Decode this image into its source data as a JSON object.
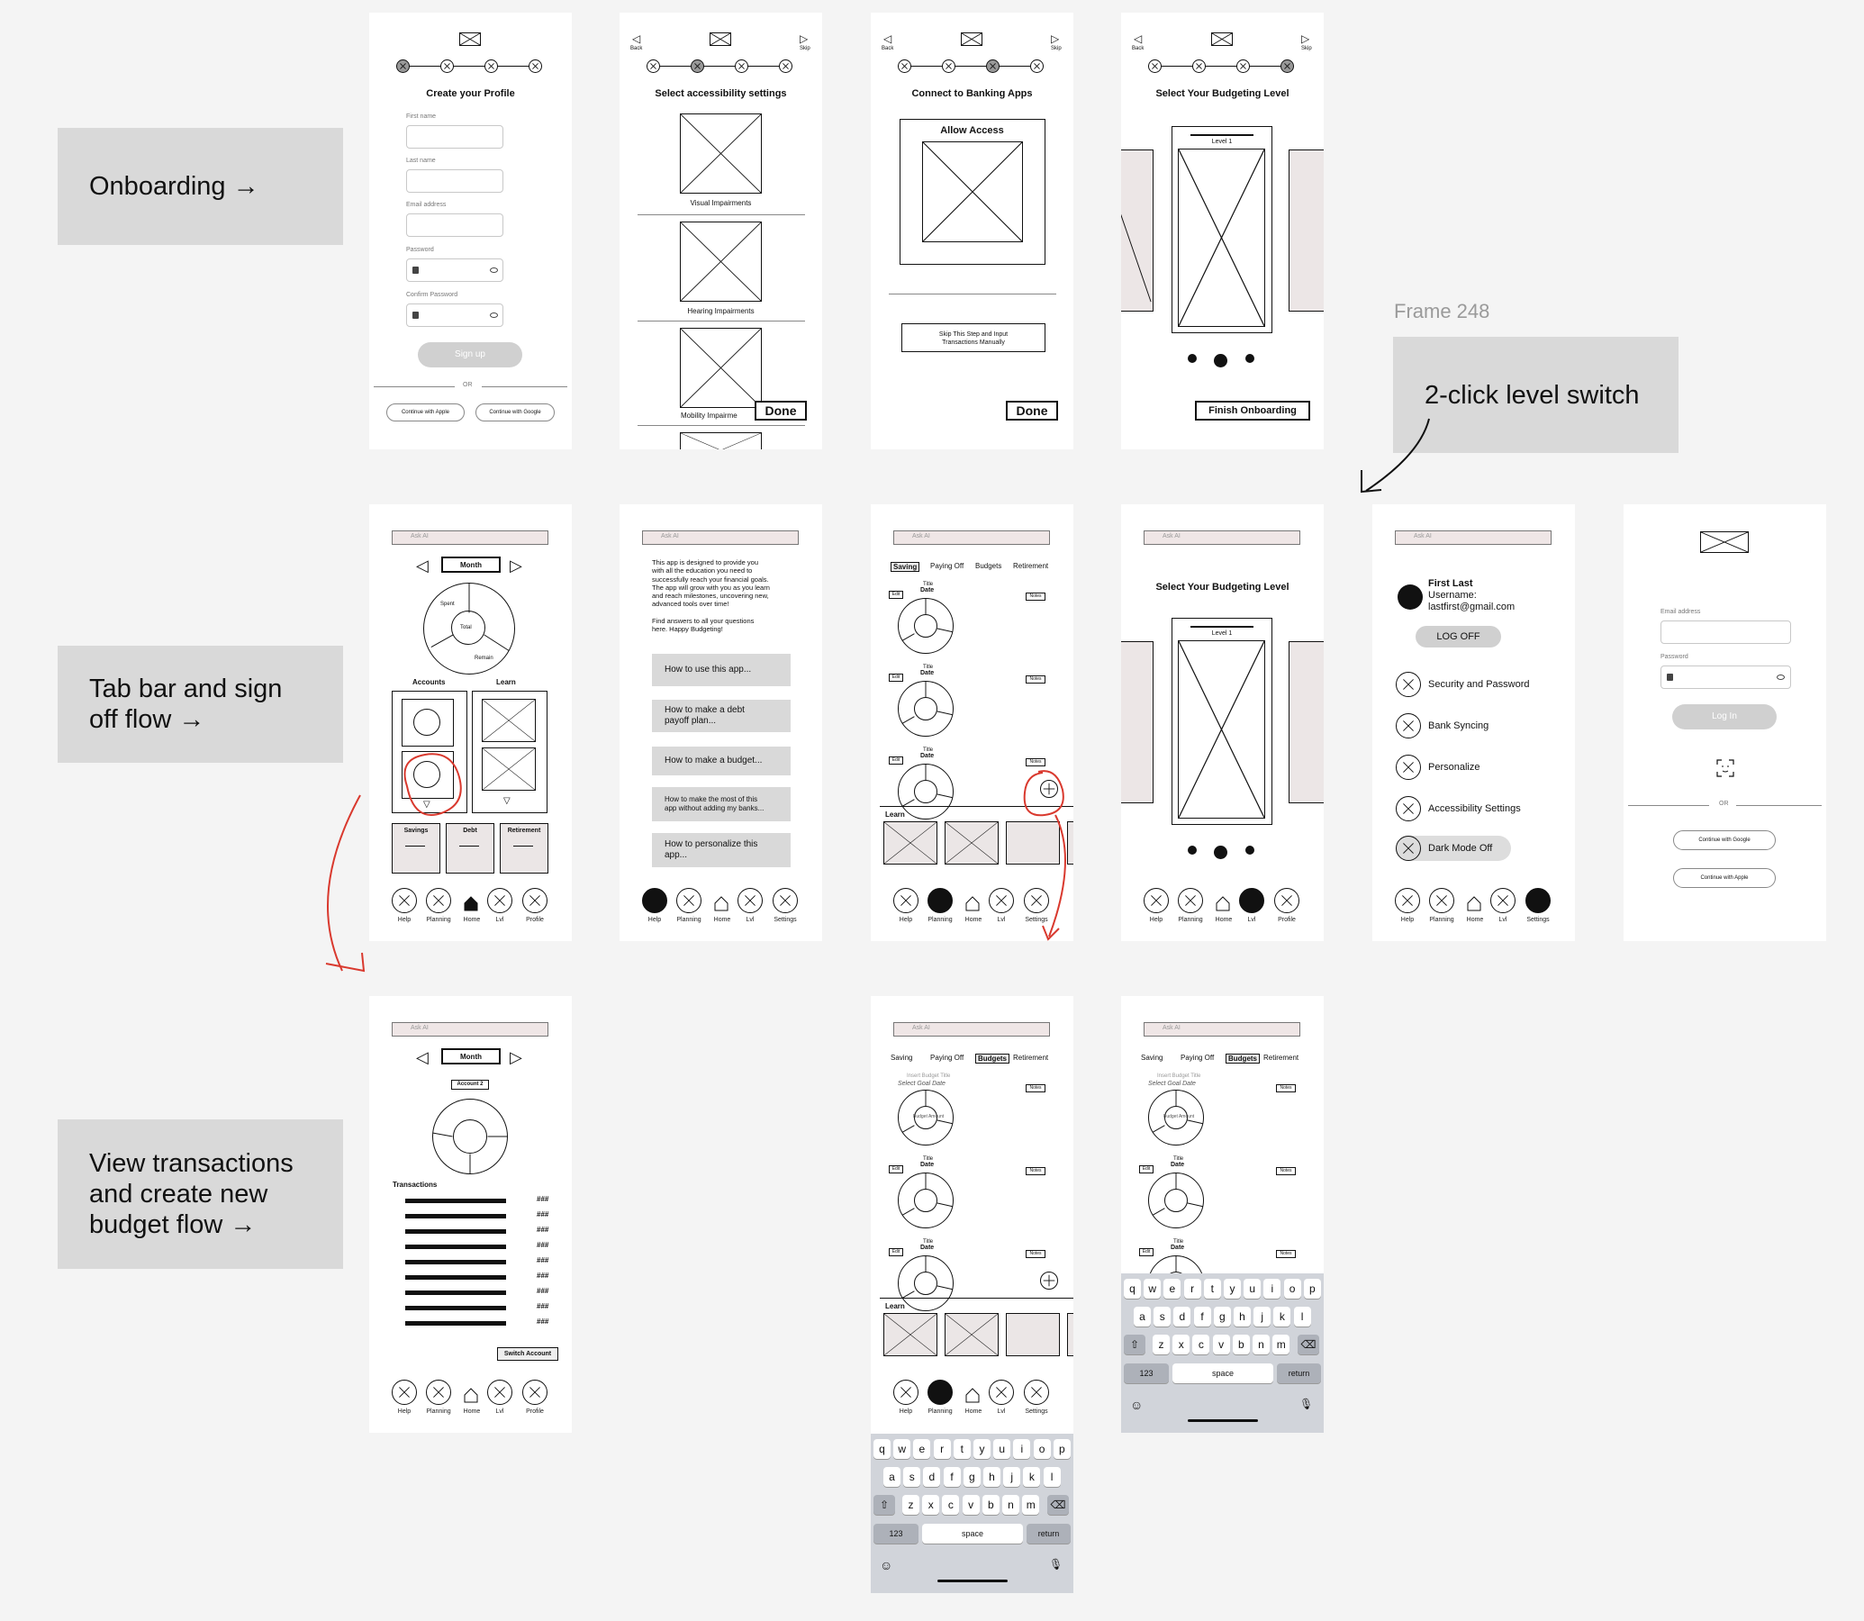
{
  "labels": {
    "onboarding": "Onboarding →",
    "tabbar_l1": "Tab bar and sign",
    "tabbar_l2": "off flow →",
    "view_l1": "View transactions",
    "view_l2": "and create new",
    "view_l3": "budget flow →",
    "frame_name": "Frame 248",
    "level_switch": "2-click level switch"
  },
  "nav": {
    "back": "Back",
    "skip": "Skip"
  },
  "signup": {
    "title": "Create your Profile",
    "first_name": "First name",
    "last_name": "Last name",
    "email": "Email address",
    "password": "Password",
    "confirm": "Confirm Password",
    "signup_btn": "Sign up",
    "or": "OR",
    "apple": "Continue with Apple",
    "google": "Continue with Google"
  },
  "access": {
    "title": "Select accessibility settings",
    "visual": "Visual Impairments",
    "hearing": "Hearing Impairments",
    "mobility": "Mobility Impairme",
    "done": "Done"
  },
  "banking": {
    "title": "Connect to Banking Apps",
    "allow": "Allow Access",
    "skip_l1": "Skip This Step and Input",
    "skip_l2": "Transactions Manually",
    "done": "Done"
  },
  "level": {
    "title": "Select Your Budgeting Level",
    "level1": "Level 1",
    "finish": "Finish Onboarding"
  },
  "home": {
    "ask": "Ask AI",
    "month": "Month",
    "spent": "Spent",
    "total": "Total",
    "remain": "Remain",
    "accounts": "Accounts",
    "learn": "Learn",
    "savings": "Savings",
    "debt": "Debt",
    "retirement": "Retirement"
  },
  "tabs": {
    "help": "Help",
    "planning": "Planning",
    "home": "Home",
    "lvl": "Lvl",
    "profile": "Profile",
    "settings": "Settings"
  },
  "help": {
    "intro": [
      "This app is designed to provide you",
      "with all the education you need to",
      "successfully reach your financial goals.",
      "The app will grow with you as you learn",
      "and reach milestones, uncovering new,",
      "advanced tools over time!",
      "",
      "Find answers to all your questions",
      "here. Happy Budgeting!"
    ],
    "q1": "How to use this app...",
    "q2a": "How to make a debt",
    "q2b": "payoff plan...",
    "q3": "How to make a budget...",
    "q4a": "How to make the most of this",
    "q4b": "app without adding my banks...",
    "q5a": "How to personalize this",
    "q5b": "app..."
  },
  "planning": {
    "saving": "Saving",
    "paying": "Paying Off",
    "budgets": "Budgets",
    "retirement": "Retirement",
    "title": "Title",
    "date": "Date",
    "edit": "Edit",
    "notes": "Notes",
    "learn": "Learn",
    "insert_title": "Insert Budget Title",
    "select_date": "Select Goal Date",
    "budget_amount": "Budget Amount"
  },
  "settings": {
    "name": "First Last",
    "username": "Username:",
    "email": "lastfirst@gmail.com",
    "logoff": "LOG OFF",
    "security": "Security and Password",
    "bank": "Bank Syncing",
    "personalize": "Personalize",
    "accessibility": "Accessibility Settings",
    "dark": "Dark Mode Off"
  },
  "login": {
    "email": "Email address",
    "password": "Password",
    "login_btn": "Log In",
    "or": "OR",
    "google": "Continue with Google",
    "apple": "Continue with Apple"
  },
  "transactions": {
    "month": "Month",
    "account": "Account 2",
    "title": "Transactions",
    "amount": "###",
    "switch": "Switch Account"
  },
  "keyboard": {
    "row1": [
      "q",
      "w",
      "e",
      "r",
      "t",
      "y",
      "u",
      "i",
      "o",
      "p"
    ],
    "row2": [
      "a",
      "s",
      "d",
      "f",
      "g",
      "h",
      "j",
      "k",
      "l"
    ],
    "row3": [
      "z",
      "x",
      "c",
      "v",
      "b",
      "n",
      "m"
    ],
    "num": "123",
    "space": "space",
    "return": "return"
  },
  "colors": {
    "annotation": "#d9392e",
    "label_bg": "#d9d9d9",
    "canvas": "#f4f4f4"
  }
}
